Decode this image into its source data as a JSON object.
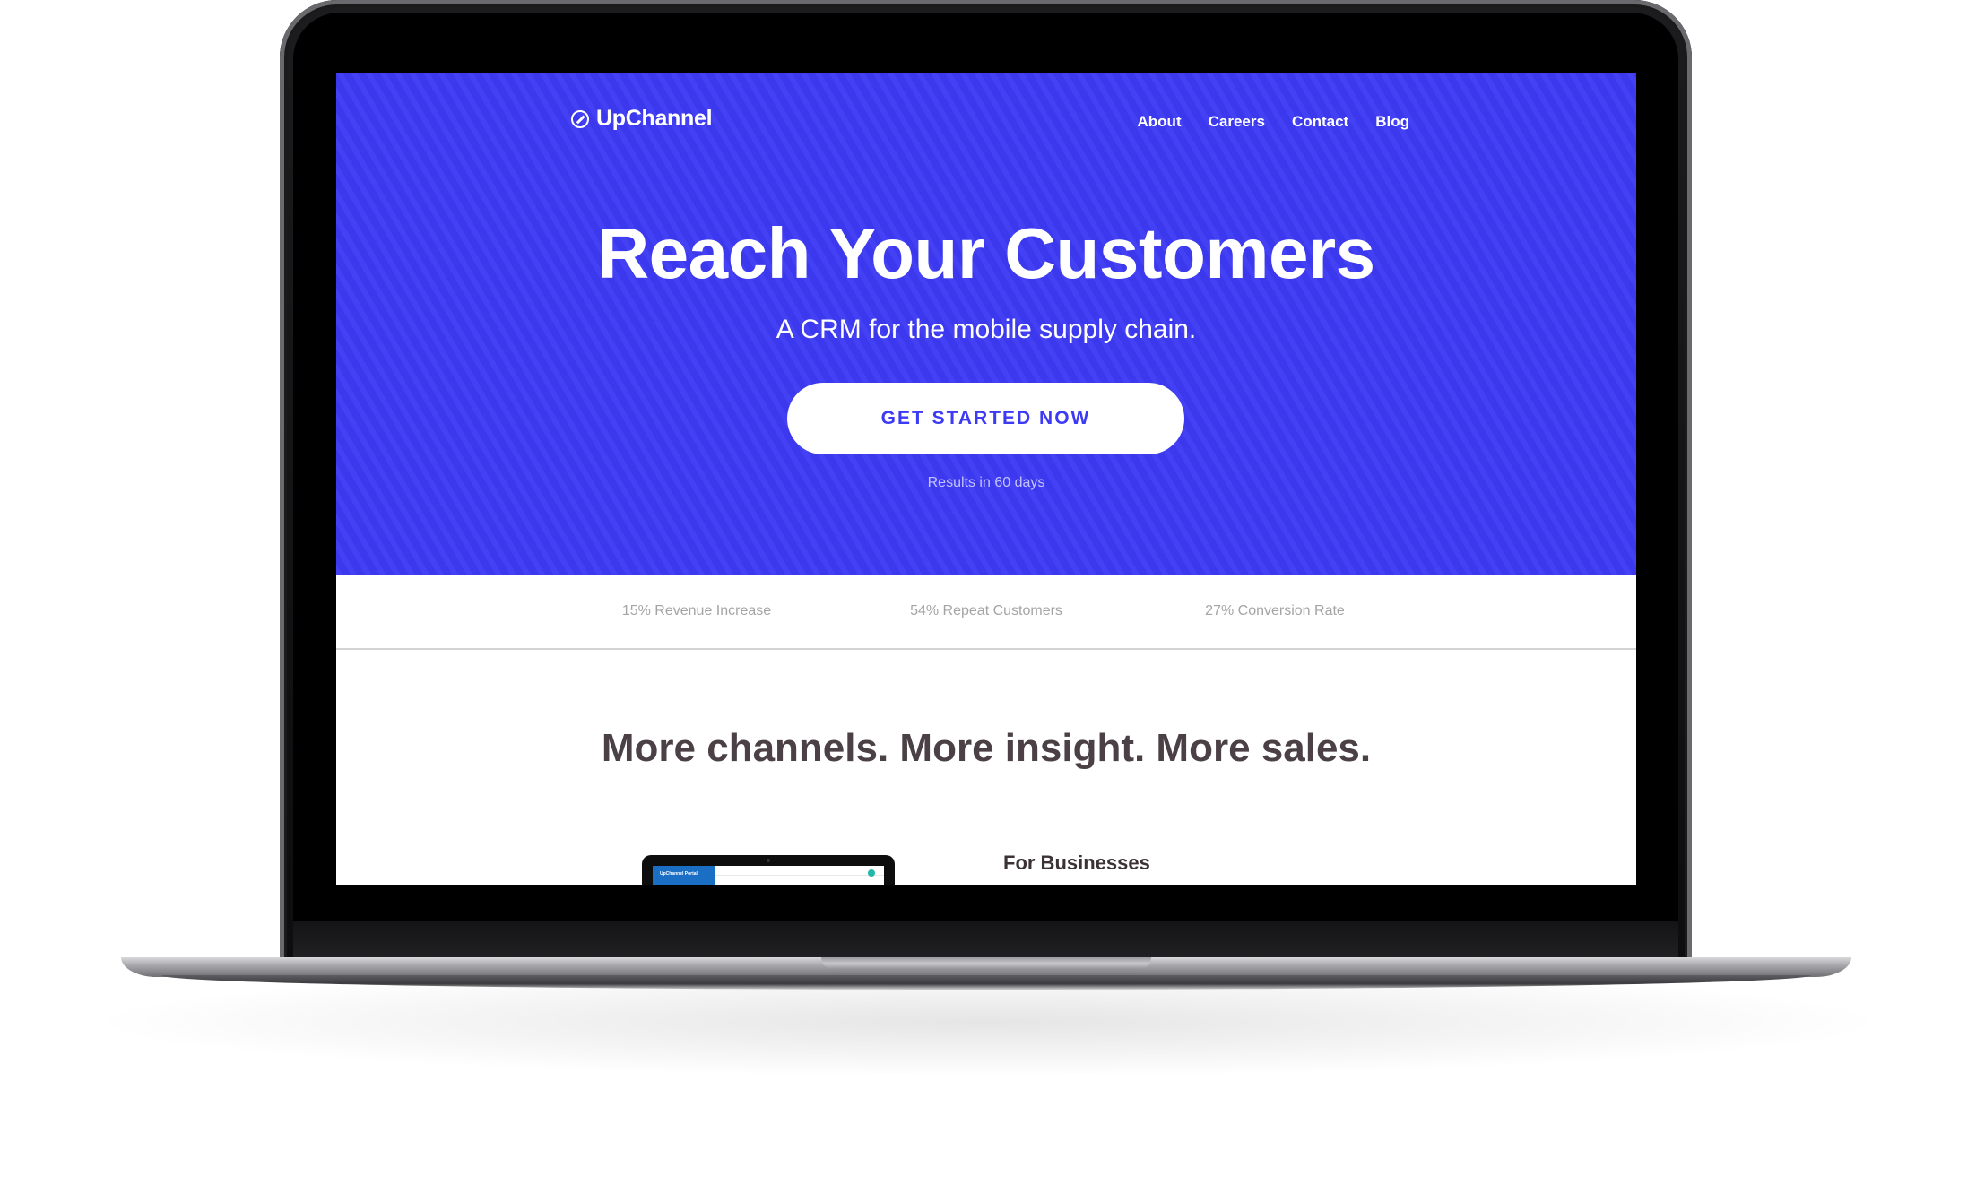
{
  "brand": {
    "name": "UpChannel",
    "color": "#3d3af5"
  },
  "nav": {
    "items": [
      "About",
      "Careers",
      "Contact",
      "Blog"
    ]
  },
  "hero": {
    "title": "Reach Your Customers",
    "subtitle": "A CRM for the mobile supply chain.",
    "cta_label": "GET STARTED NOW",
    "cta_note": "Results in 60 days"
  },
  "stats": [
    "15% Revenue Increase",
    "54% Repeat Customers",
    "27% Conversion Rate"
  ],
  "features": {
    "title": "More channels. More insight. More sales.",
    "preview_label": "UpChannel Portal",
    "first_heading": "For Businesses"
  },
  "icons": {
    "logo": "upchannel-logo-icon",
    "status": "status-dot-icon"
  }
}
